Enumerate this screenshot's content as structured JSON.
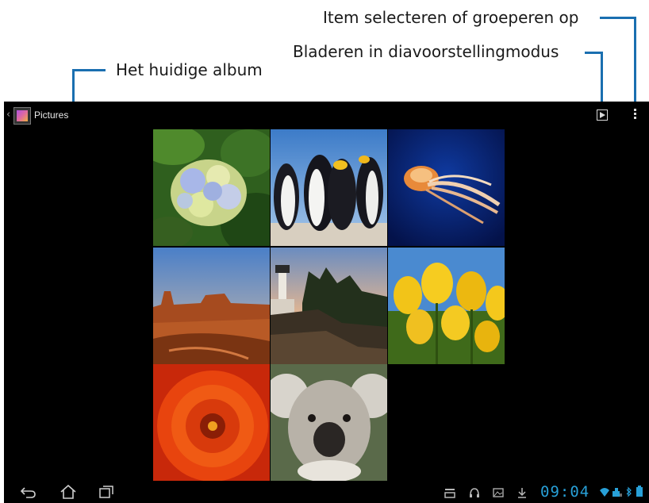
{
  "callouts": {
    "select_group": "Item selecteren of groeperen op",
    "slideshow": "Bladeren in diavoorstellingmodus",
    "current_album": "Het huidige album"
  },
  "actionbar": {
    "album_title": "Pictures",
    "icons": [
      "back-caret-icon",
      "gallery-app-icon",
      "slideshow-icon",
      "overflow-menu-icon"
    ]
  },
  "gallery": {
    "photos": [
      "hydrangea-flower",
      "penguins",
      "jellyfish",
      "desert",
      "lighthouse",
      "tulips",
      "chrysanthemum",
      "koala"
    ]
  },
  "statusbar": {
    "time": "09:04",
    "icons": [
      "download-tray-icon",
      "headphones-icon",
      "picture-icon",
      "download-icon",
      "wifi-icon",
      "signal-icon",
      "battery-icon"
    ]
  },
  "navbar": {
    "icons": [
      "back-icon",
      "home-icon",
      "recent-apps-icon"
    ]
  },
  "colors": {
    "callout_line": "#1a6fb0",
    "clock": "#28a0d8",
    "screen_bg": "#000000"
  }
}
